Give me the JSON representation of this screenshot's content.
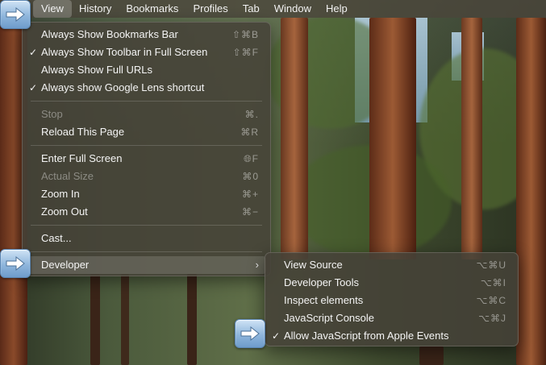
{
  "menubar": {
    "items": [
      "View",
      "History",
      "Bookmarks",
      "Profiles",
      "Tab",
      "Window",
      "Help"
    ]
  },
  "view_menu": {
    "groups": [
      [
        {
          "label": "Always Show Bookmarks Bar",
          "shortcut": "⇧⌘B",
          "checked": false,
          "disabled": false
        },
        {
          "label": "Always Show Toolbar in Full Screen",
          "shortcut": "⇧⌘F",
          "checked": true,
          "disabled": false
        },
        {
          "label": "Always Show Full URLs",
          "shortcut": "",
          "checked": false,
          "disabled": false
        },
        {
          "label": "Always show Google Lens shortcut",
          "shortcut": "",
          "checked": true,
          "disabled": false
        }
      ],
      [
        {
          "label": "Stop",
          "shortcut": "⌘.",
          "checked": false,
          "disabled": true
        },
        {
          "label": "Reload This Page",
          "shortcut": "⌘R",
          "checked": false,
          "disabled": false
        }
      ],
      [
        {
          "label": "Enter Full Screen",
          "shortcut": "🌐︎F",
          "checked": false,
          "disabled": false
        },
        {
          "label": "Actual Size",
          "shortcut": "⌘0",
          "checked": false,
          "disabled": true
        },
        {
          "label": "Zoom In",
          "shortcut": "⌘+",
          "checked": false,
          "disabled": false
        },
        {
          "label": "Zoom Out",
          "shortcut": "⌘−",
          "checked": false,
          "disabled": false
        }
      ],
      [
        {
          "label": "Cast...",
          "shortcut": "",
          "checked": false,
          "disabled": false
        }
      ],
      [
        {
          "label": "Developer",
          "shortcut": "",
          "checked": false,
          "disabled": false,
          "submenu": true,
          "highlighted": true
        }
      ]
    ]
  },
  "developer_menu": {
    "items": [
      {
        "label": "View Source",
        "shortcut": "⌥⌘U",
        "checked": false
      },
      {
        "label": "Developer Tools",
        "shortcut": "⌥⌘I",
        "checked": false
      },
      {
        "label": "Inspect elements",
        "shortcut": "⌥⌘C",
        "checked": false
      },
      {
        "label": "JavaScript Console",
        "shortcut": "⌥⌘J",
        "checked": false
      },
      {
        "label": "Allow JavaScript from Apple Events",
        "shortcut": "",
        "checked": true
      }
    ]
  },
  "icons": {
    "callout": "right-arrow-callout-icon",
    "check": "checkmark-icon",
    "submenu": "chevron-right-icon"
  },
  "colors": {
    "callout_blue": "#8fb6dc",
    "menu_bg": "#46423a"
  }
}
